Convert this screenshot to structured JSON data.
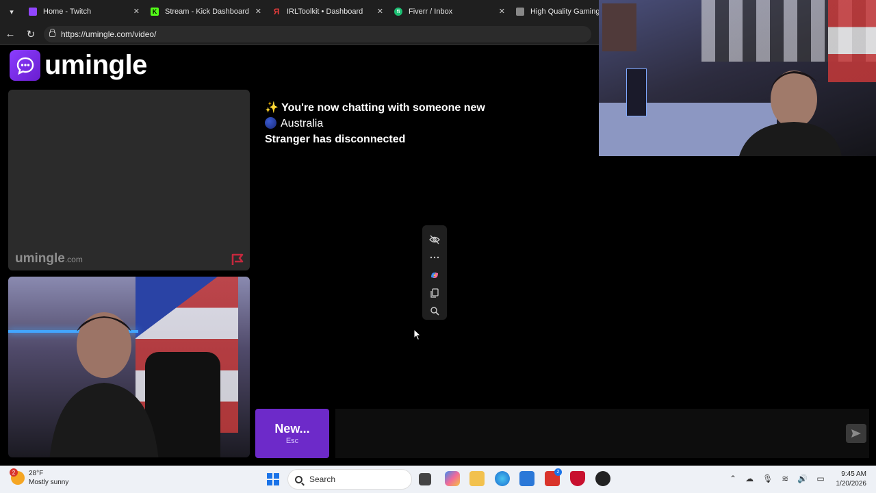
{
  "browser": {
    "tabs": [
      {
        "title": "Home - Twitch",
        "color": "#9146ff",
        "glyph": ""
      },
      {
        "title": "Stream - Kick Dashboard",
        "color": "#53fc18",
        "glyph": "K"
      },
      {
        "title": "IRLToolkit • Dashboard",
        "color": "#e23b3b",
        "glyph": "Я"
      },
      {
        "title": "Fiverr / Inbox",
        "color": "#1dbf73",
        "glyph": "fi"
      },
      {
        "title": "High Quality Gaming Ge",
        "color": "#888888",
        "glyph": ""
      }
    ],
    "close_glyph": "✕",
    "url": "https://umingle.com/video/"
  },
  "page": {
    "logo_text": "umingle",
    "watermark_text": "umingle",
    "watermark_suffix": ".com",
    "messages": [
      {
        "icon": "✨",
        "text": "You're now chatting with someone new",
        "bold": true
      },
      {
        "icon": "flag",
        "text": "Australia",
        "bold": false
      },
      {
        "icon": "",
        "text": "Stranger has disconnected",
        "bold": true
      }
    ],
    "new_button_label": "New...",
    "new_button_hint": "Esc",
    "message_placeholder": ""
  },
  "mini_toolbar": {
    "icons": [
      "eye-off-icon",
      "more-icon",
      "copilot-icon",
      "copy-icon",
      "search-icon"
    ]
  },
  "taskbar": {
    "weather_badge": "2",
    "temperature": "28°F",
    "condition": "Mostly sunny",
    "search_label": "Search",
    "mail_badge": "2",
    "time": "9:45 AM",
    "date": "1/20/2026"
  },
  "colors": {
    "accent": "#6d2ac9",
    "logo_gradient": "#8b3dff"
  }
}
